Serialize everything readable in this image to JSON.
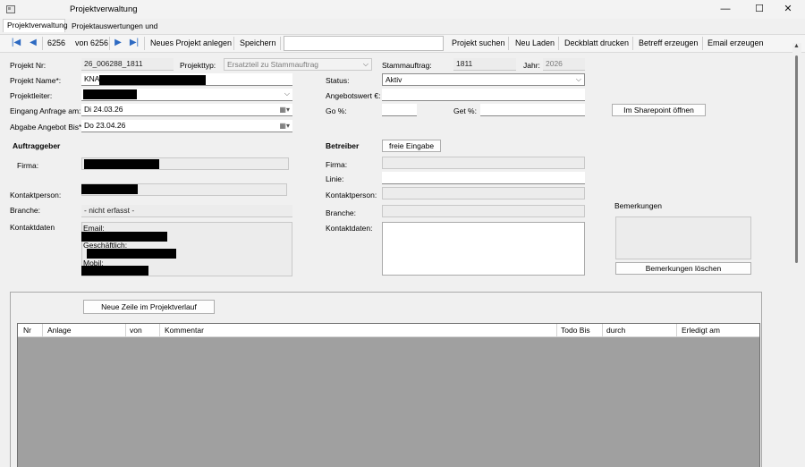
{
  "window": {
    "title": "Projektverwaltung",
    "minimize": "—",
    "maximize": "☐",
    "close": "✕"
  },
  "tabs": [
    {
      "label": "Projektverwaltung",
      "active": true
    },
    {
      "label": "Projektauswertungen und Listen",
      "active": false
    }
  ],
  "toolbar": {
    "first_icon": "first-record-icon",
    "prev_icon": "previous-record-icon",
    "record_current": "6256",
    "record_total": "von 6256",
    "next_icon": "next-record-icon",
    "last_icon": "last-record-icon",
    "new_project": "Neues Projekt anlegen",
    "save": "Speichern",
    "search_value": "",
    "search_project": "Projekt suchen",
    "reload": "Neu Laden",
    "cover_print": "Deckblatt drucken",
    "subject_create": "Betreff erzeugen",
    "email_create": "Email erzeugen"
  },
  "form": {
    "project_nr_label": "Projekt Nr:",
    "project_nr": "26_006288_1811",
    "project_type_label": "Projekttyp:",
    "project_type": "Ersatzteil zu Stammauftrag",
    "stamm_label": "Stammauftrag:",
    "stamm": "1811",
    "year_label": "Jahr:",
    "year": "2026",
    "project_name_label": "Projekt Name*:",
    "project_name": "KNA",
    "status_label": "Status:",
    "status": "Aktiv",
    "leader_label": "Projektleiter:",
    "offer_value_label": "Angebotswert €:",
    "offer_value": "",
    "arrival_label": "Eingang Anfrage am:",
    "arrival": "Di  24.03.26",
    "go_label": "Go %:",
    "go": "",
    "get_label": "Get %:",
    "get": "",
    "sharepoint_button": "Im  Sharepoint öffnen",
    "offer_until_label": "Abgabe Angebot Bis*:",
    "offer_until": "Do 23.04.26"
  },
  "client": {
    "heading": "Auftraggeber",
    "company_label": "Firma:",
    "contact_label": "Kontaktperson:",
    "branch_label": "Branche:",
    "branch": "- nicht erfasst -",
    "contact_data_label": "Kontaktdaten",
    "email_label": "Email:",
    "business_label": "Geschäftlich:",
    "mobile_label": "Mobil:"
  },
  "operator": {
    "heading": "Betreiber",
    "free_entry": "freie Eingabe",
    "company_label": "Firma:",
    "line_label": "Linie:",
    "contact_label": "Kontaktperson:",
    "branch_label": "Branche:",
    "contact_data_label": "Kontaktdaten:"
  },
  "remarks": {
    "label": "Bemerkungen",
    "clear_button": "Bemerkungen löschen"
  },
  "history": {
    "new_row_button": "Neue Zeile im Projektverlauf",
    "columns": [
      "Nr",
      "Anlage",
      "von",
      "Kommentar",
      "Todo Bis",
      "durch",
      "Erledigt am"
    ]
  },
  "colors": {
    "accent": "#2d6ac2",
    "grid_body": "#a0a0a0",
    "window_bg": "#f0f0f0"
  }
}
